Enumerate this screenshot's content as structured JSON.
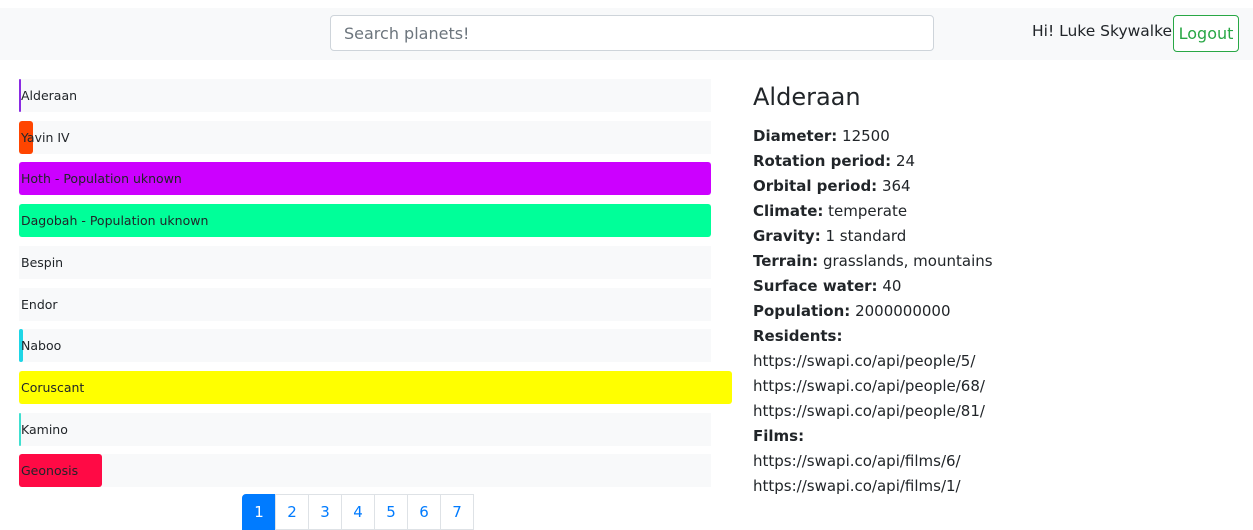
{
  "header": {
    "search_placeholder": "Search planets!",
    "greeting": "Hi! Luke Skywalker",
    "logout_label": "Logout"
  },
  "planets": [
    {
      "label": "Alderaan",
      "color": "#8a2be2",
      "fill": 0.003,
      "text_color": "#212529"
    },
    {
      "label": "Yavin IV",
      "color": "#ff4500",
      "fill": 0.02,
      "text_color": "#212529"
    },
    {
      "label": "Hoth - Population uknown",
      "color": "#cc00ff",
      "fill": 1.0,
      "text_color": "#212529"
    },
    {
      "label": "Dagobah - Population uknown",
      "color": "#00ff99",
      "fill": 1.0,
      "text_color": "#212529"
    },
    {
      "label": "Bespin",
      "color": "#f8f9fa",
      "fill": 0.0,
      "text_color": "#212529"
    },
    {
      "label": "Endor",
      "color": "#f8f9fa",
      "fill": 0.0,
      "text_color": "#212529"
    },
    {
      "label": "Naboo",
      "color": "#1ed6e6",
      "fill": 0.006,
      "text_color": "#212529"
    },
    {
      "label": "Coruscant",
      "color": "#ffff00",
      "fill": 1.03,
      "text_color": "#212529"
    },
    {
      "label": "Kamino",
      "color": "#40e0d0",
      "fill": 0.002,
      "text_color": "#212529"
    },
    {
      "label": "Geonosis",
      "color": "#ff0a45",
      "fill": 0.12,
      "text_color": "#212529"
    }
  ],
  "pagination": {
    "pages": [
      "1",
      "2",
      "3",
      "4",
      "5",
      "6",
      "7"
    ],
    "active": "1"
  },
  "detail": {
    "title": "Alderaan",
    "diameter_label": "Diameter:",
    "diameter": "12500",
    "rotation_label": "Rotation period:",
    "rotation": "24",
    "orbital_label": "Orbital period:",
    "orbital": "364",
    "climate_label": "Climate:",
    "climate": "temperate",
    "gravity_label": "Gravity:",
    "gravity": "1 standard",
    "terrain_label": "Terrain:",
    "terrain": "grasslands, mountains",
    "water_label": "Surface water:",
    "water": "40",
    "population_label": "Population:",
    "population": "2000000000",
    "residents_label": "Residents:",
    "residents": [
      "https://swapi.co/api/people/5/",
      "https://swapi.co/api/people/68/",
      "https://swapi.co/api/people/81/"
    ],
    "films_label": "Films:",
    "films": [
      "https://swapi.co/api/films/6/",
      "https://swapi.co/api/films/1/"
    ]
  },
  "colors": {
    "accent": "#007bff",
    "logout": "#28a745"
  }
}
